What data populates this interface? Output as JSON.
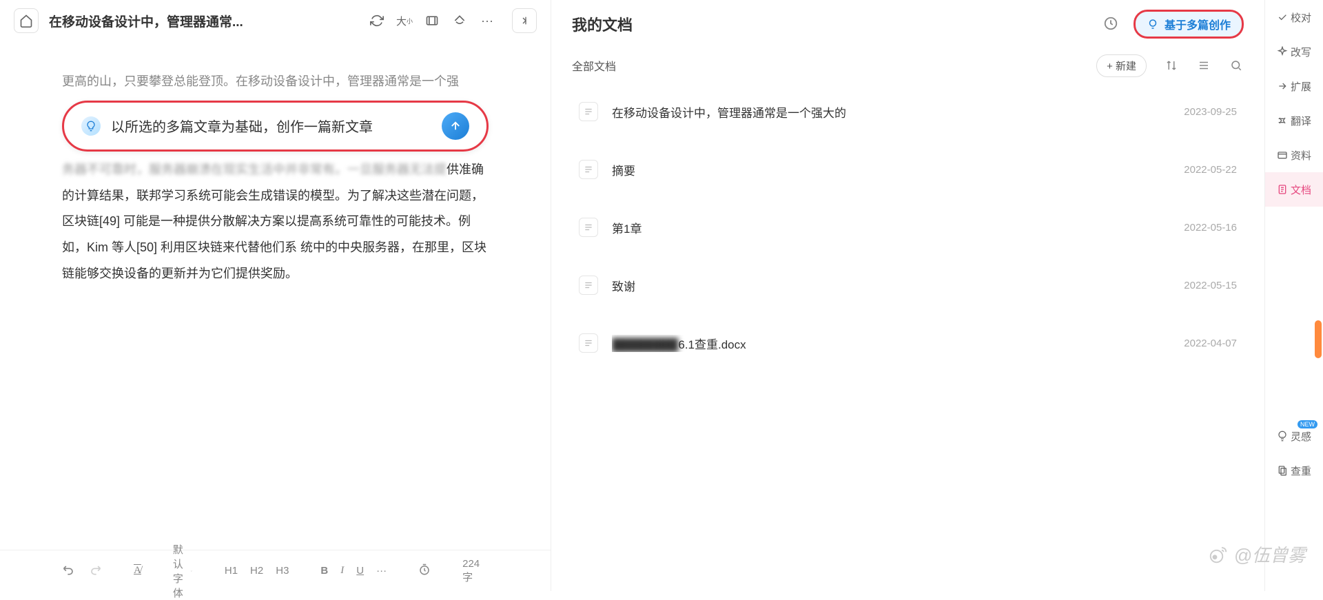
{
  "editor": {
    "title": "在移动设备设计中，管理器通常...",
    "line1": "更高的山，只要攀登总能登顶。在移动设备设计中，管理器通常是一个强",
    "compose_prompt": "以所选的多篇文章为基础，创作一篇新文章",
    "line2_obscured": "务器不可靠时，服务器崩溃在现实生活中并非常有。一旦服务器无法提",
    "body_rest": "供准确的计算结果，联邦学习系统可能会生成错误的模型。为了解决这些潜在问题，区块链[49] 可能是一种提供分散解决方案以提高系统可靠性的可能技术。例如，Kim 等人[50] 利用区块链来代替他们系 统中的中央服务器，在那里，区块链能够交换设备的更新并为它们提供奖励。"
  },
  "formatbar": {
    "font_label": "默认字体",
    "h1": "H1",
    "h2": "H2",
    "h3": "H3",
    "bold": "B",
    "italic": "I",
    "underline": "U",
    "more": "···",
    "word_count": "224 字"
  },
  "right": {
    "title": "我的文档",
    "compose_multi": "基于多篇创作",
    "tab_all": "全部文档",
    "new_btn": "+ 新建",
    "files": [
      {
        "name": "在移动设备设计中，管理器通常是一个强大的",
        "date": "2023-09-25"
      },
      {
        "name": "摘要",
        "date": "2022-05-22"
      },
      {
        "name": "第1章",
        "date": "2022-05-16"
      },
      {
        "name": "致谢",
        "date": "2022-05-15"
      },
      {
        "name_prefix_blur": "████████",
        "name_suffix": "6.1查重.docx",
        "date": "2022-04-07"
      }
    ]
  },
  "side": [
    {
      "icon": "check",
      "label": "校对"
    },
    {
      "icon": "sparkle",
      "label": "改写"
    },
    {
      "icon": "expand",
      "label": "扩展"
    },
    {
      "icon": "translate",
      "label": "翻译"
    },
    {
      "icon": "folder",
      "label": "资料"
    },
    {
      "icon": "doc",
      "label": "文档",
      "active": true
    },
    {
      "gap": true
    },
    {
      "icon": "bulb",
      "label": "灵感",
      "new": true
    },
    {
      "icon": "dup",
      "label": "查重"
    }
  ],
  "watermark": "@伍曾雾"
}
